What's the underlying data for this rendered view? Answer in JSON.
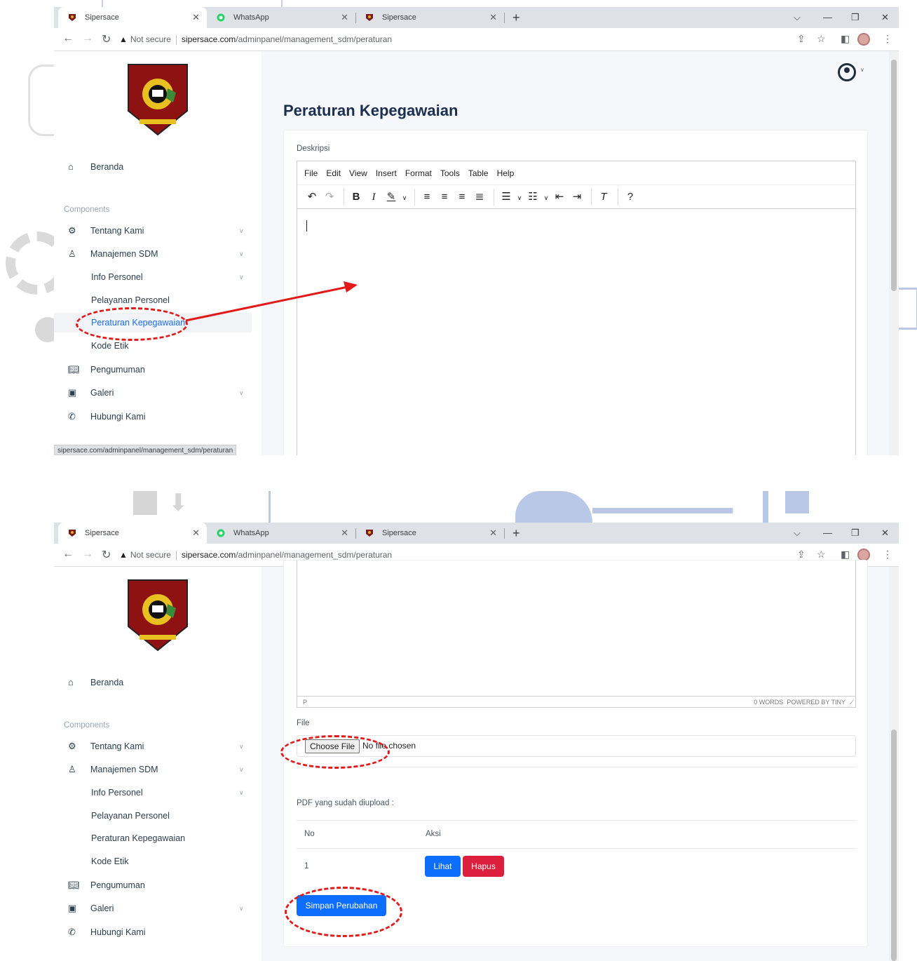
{
  "browser": {
    "tabs": [
      {
        "title": "Sipersace",
        "close": "✕"
      },
      {
        "title": "WhatsApp",
        "close": "✕"
      },
      {
        "title": "Sipersace",
        "close": "✕"
      }
    ],
    "new_tab": "+",
    "not_secure": "Not secure",
    "url_domain": "sipersace.com",
    "url_path": "/adminpanel/management_sdm/peraturan",
    "status_url": "sipersace.com/adminpanel/management_sdm/peraturan"
  },
  "sidebar": {
    "section_label": "Components",
    "items": [
      {
        "label": "Beranda"
      },
      {
        "label": "Tentang Kami"
      },
      {
        "label": "Manajemen SDM"
      },
      {
        "label": "Info Personel"
      },
      {
        "label": "Pelayanan Personel"
      },
      {
        "label": "Peraturan Kepegawaian"
      },
      {
        "label": "Kode Etik"
      },
      {
        "label": "Pengumuman"
      },
      {
        "label": "Galeri"
      },
      {
        "label": "Hubungi Kami"
      }
    ]
  },
  "page": {
    "title": "Peraturan Kepegawaian",
    "description_label": "Deskripsi",
    "editor_menu": [
      "File",
      "Edit",
      "View",
      "Insert",
      "Format",
      "Tools",
      "Table",
      "Help"
    ],
    "editor_status_tag": "P",
    "editor_word_count": "0 WORDS",
    "editor_powered": "POWERED BY TINY",
    "file_label": "File",
    "choose_file": "Choose File",
    "no_file": "No file chosen",
    "uploaded_label": "PDF yang sudah diupload :",
    "table_headers": [
      "No",
      "Aksi"
    ],
    "table_rows": [
      {
        "no": "1"
      }
    ],
    "view_button": "Lihat",
    "delete_button": "Hapus",
    "save_button": "Simpan Perubahan"
  },
  "colors": {
    "primary": "#0d6efd",
    "danger": "#dc1f3c",
    "annotation": "#e21a1a",
    "title": "#1a2e4f"
  }
}
